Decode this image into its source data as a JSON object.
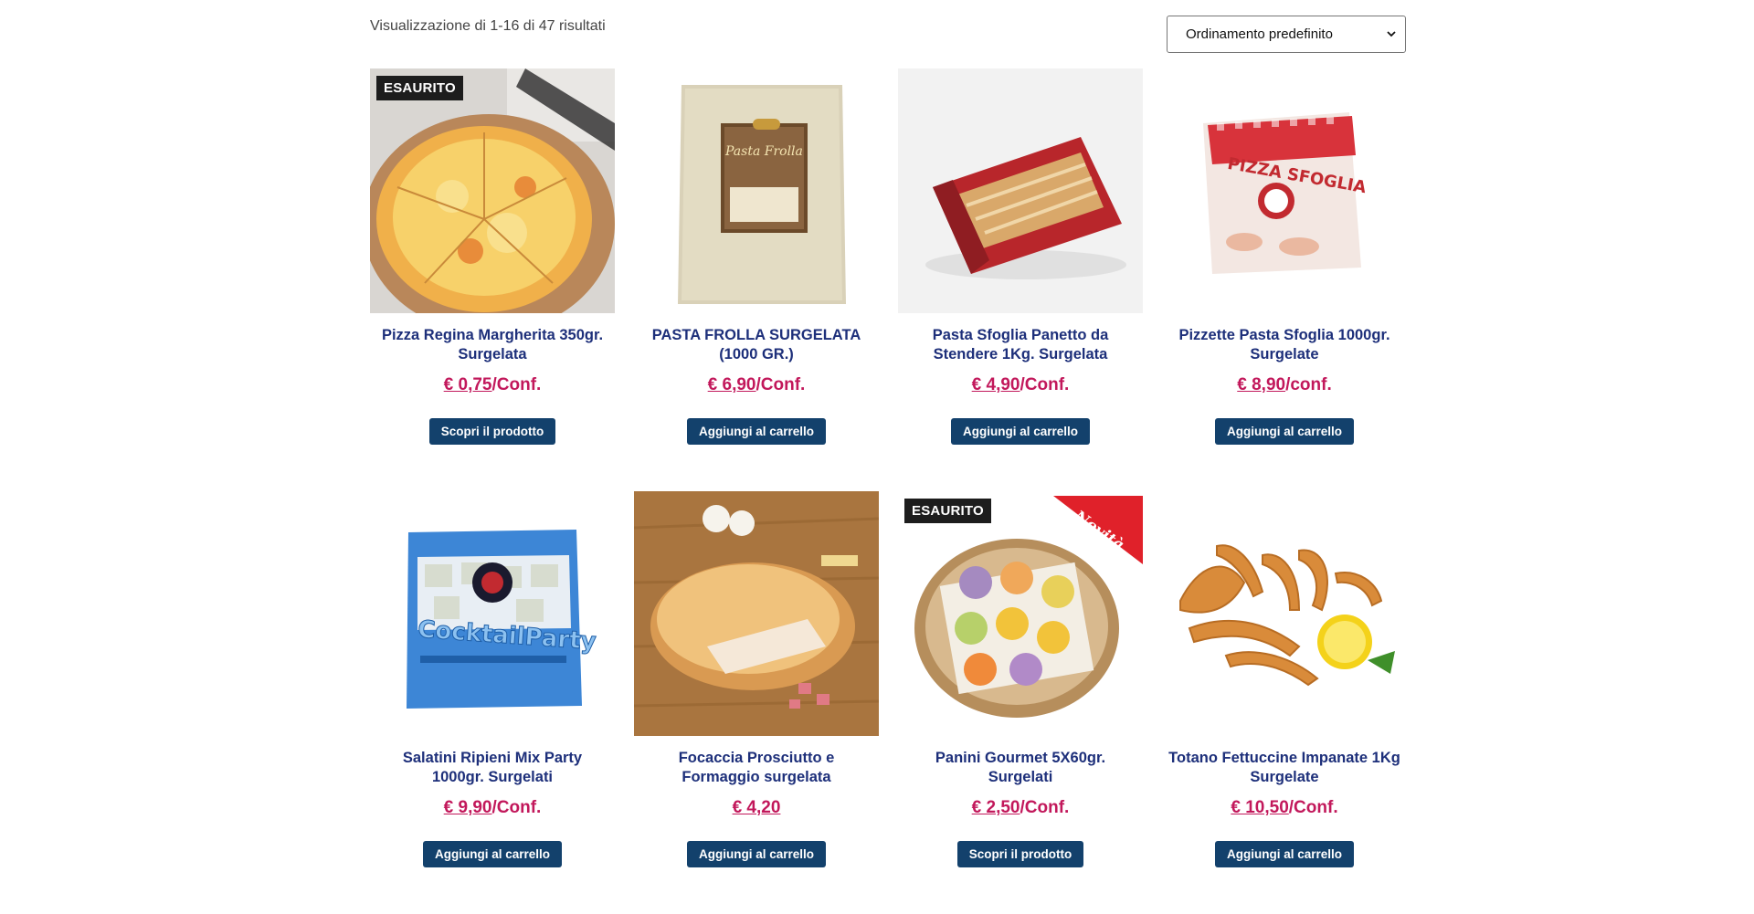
{
  "result_count": "Visualizzazione di 1-16 di 47 risultati",
  "orderby": {
    "selected": "Ordinamento predefinito",
    "icon": "chevron-down-icon"
  },
  "colors": {
    "title": "#1d2f7a",
    "price": "#c2185b",
    "button": "#13416c",
    "badge": "#1d1d1d"
  },
  "products": [
    {
      "badge": "ESAURITO",
      "title": "Pizza Regina Margherita 350gr. Surgelata",
      "price_amount": "€ 0,75",
      "price_unit": "/Conf.",
      "button": "Scopri il prodotto"
    },
    {
      "badge": "",
      "title": "PASTA FROLLA SURGELATA (1000 GR.)",
      "price_amount": "€ 6,90",
      "price_unit": "/Conf.",
      "button": "Aggiungi al carrello"
    },
    {
      "badge": "",
      "title": "Pasta Sfoglia Panetto da Stendere 1Kg. Surgelata",
      "price_amount": "€ 4,90",
      "price_unit": "/Conf.",
      "button": "Aggiungi al carrello"
    },
    {
      "badge": "",
      "title": "Pizzette Pasta Sfoglia 1000gr. Surgelate",
      "price_amount": "€ 8,90",
      "price_unit": "/conf.",
      "button": "Aggiungi al carrello"
    },
    {
      "badge": "",
      "title": "Salatini Ripieni Mix Party 1000gr. Surgelati",
      "price_amount": "€ 9,90",
      "price_unit": "/Conf.",
      "button": "Aggiungi al carrello"
    },
    {
      "badge": "",
      "title": "Focaccia Prosciutto e Formaggio surgelata",
      "price_amount": "€ 4,20",
      "price_unit": "",
      "button": "Aggiungi al carrello"
    },
    {
      "badge": "ESAURITO",
      "title": "Panini Gourmet 5X60gr. Surgelati",
      "price_amount": "€ 2,50",
      "price_unit": "/Conf.",
      "button": "Scopri il prodotto"
    },
    {
      "badge": "",
      "title": "Totano Fettuccine Impanate 1Kg Surgelate",
      "price_amount": "€ 10,50",
      "price_unit": "/Conf.",
      "button": "Aggiungi al carrello"
    }
  ],
  "image_texts": {
    "pasta_frolla_brand": "Pasta Frolla",
    "pizzette_brand": "PIZZA SFOGLIA",
    "cocktail_brand": "CocktailParty",
    "novita_ribbon": "Novità"
  }
}
